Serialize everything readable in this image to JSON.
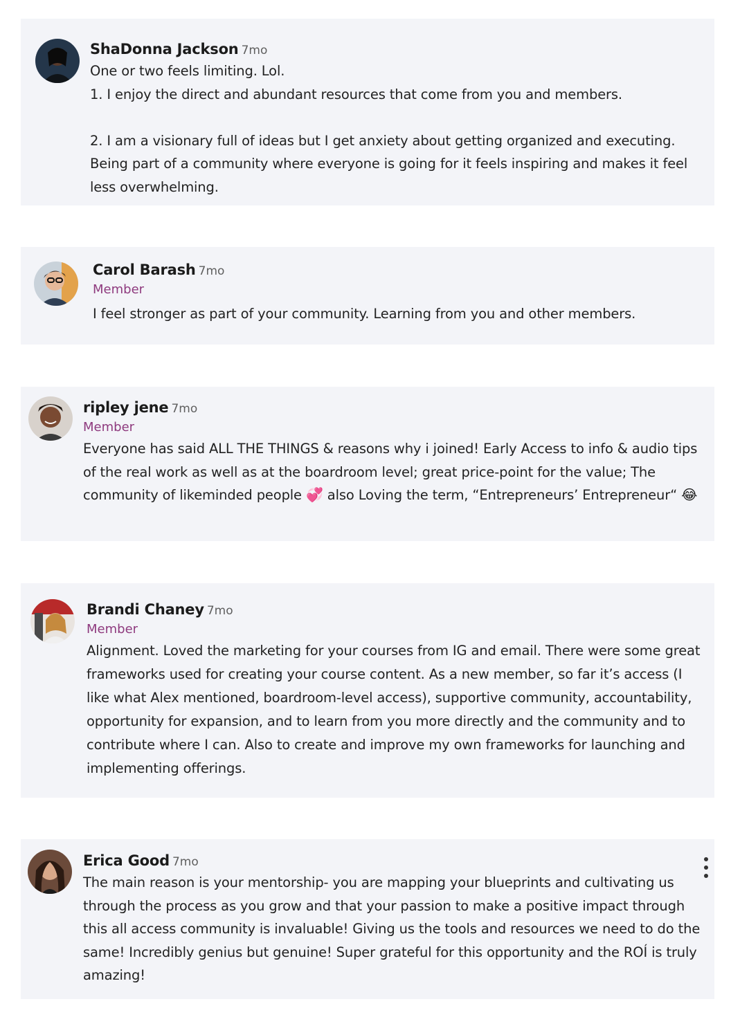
{
  "posts": [
    {
      "name": "ShaDonna Jackson",
      "time": "7mo",
      "role": "",
      "text": "One or two feels limiting. Lol.\n1. I enjoy the direct and abundant resources that come from you and members.\n\n2. I am a visionary full of ideas but I get anxiety about getting organized and executing. Being part of a community where everyone is going for it feels inspiring and makes it feel less overwhelming."
    },
    {
      "name": "Carol Barash",
      "time": "7mo",
      "role": "Member",
      "text": "I feel stronger as part of your community. Learning from you and other members."
    },
    {
      "name": "ripley jene",
      "time": "7mo",
      "role": "Member",
      "text_parts": [
        "Everyone has said ALL THE THINGS & reasons why i joined! Early Access to info & audio tips of the real work as well as at the boardroom level; great price-point for the value; The community of likeminded people ",
        "💞",
        " also Loving the term, “Entrepreneurs’ Entrepreneur“ ",
        "😂"
      ]
    },
    {
      "name": "Brandi Chaney",
      "time": "7mo",
      "role": "Member",
      "text": "Alignment. Loved the marketing for your courses from IG and email. There were some great frameworks used for creating your course content. As a new member, so far it’s access (I like what Alex mentioned, boardroom-level access), supportive community, accountability, opportunity for expansion, and to learn from you more directly and the community and to contribute where I can. Also to create and improve my own frameworks for launching and implementing offerings."
    },
    {
      "name": "Erica Good",
      "time": "7mo",
      "role": "",
      "text": "The main reason is your mentorship- you are mapping your blueprints and cultivating us through the process as you grow and that your passion to make a positive impact through this all access community is invaluable! Giving us the tools and resources we need to do the same! Incredibly genius but genuine! Super grateful for this opportunity and the ROÍ is truly amazing!"
    }
  ]
}
